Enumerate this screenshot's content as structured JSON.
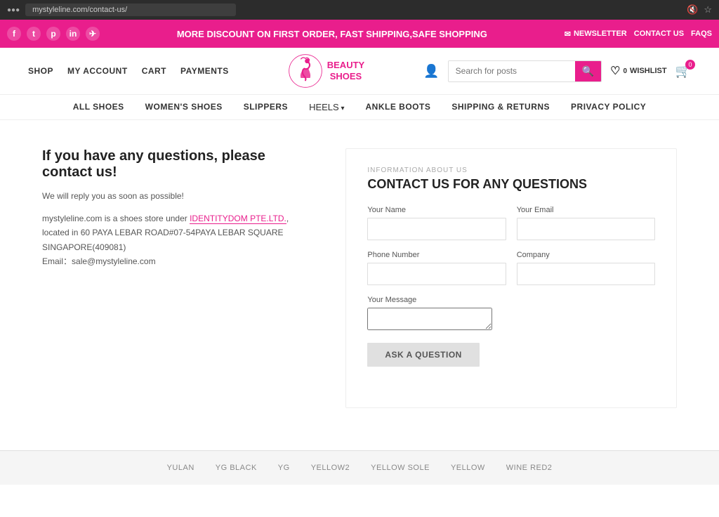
{
  "browser": {
    "url": "mystyleline.com/contact-us/"
  },
  "promo": {
    "text": "MORE DISCOUNT ON FIRST ORDER, FAST SHIPPING,SAFE SHOPPING",
    "newsletter_label": "NEWSLETTER",
    "contact_label": "CONTACT US",
    "faqs_label": "FAQS"
  },
  "header": {
    "nav_items": [
      "SHOP",
      "MY ACCOUNT",
      "CART",
      "PAYMENTS"
    ],
    "logo_line1": "BEAUTY",
    "logo_line2": "SHOES",
    "search_placeholder": "Search for posts",
    "wishlist_label": "WISHLIST",
    "wishlist_count": "0",
    "cart_count": "0"
  },
  "main_nav": {
    "items": [
      {
        "label": "ALL SHOES",
        "active": false
      },
      {
        "label": "WOMEN'S SHOES",
        "active": false
      },
      {
        "label": "SLIPPERS",
        "active": false
      },
      {
        "label": "HEELS",
        "active": false,
        "dropdown": true
      },
      {
        "label": "ANKLE BOOTS",
        "active": false
      },
      {
        "label": "SHIPPING & RETURNS",
        "active": false
      },
      {
        "label": "PRIVACY POLICY",
        "active": false
      }
    ]
  },
  "contact_left": {
    "heading": "If you have any questions, please contact us!",
    "subtext": "We will reply you as soon as possible!",
    "description_prefix": "mystyleline.com is a shoes store under ",
    "company_name": "IDENTITYDOM PTE.LTD.",
    "description_suffix": ", located in 60 PAYA LEBAR ROAD#07-54PAYA LEBAR SQUARE SINGAPORE(409081)",
    "email_label": "Email：",
    "email": "sale@mystyleline.com"
  },
  "contact_form": {
    "info_label": "INFORMATION ABOUT US",
    "title": "CONTACT US FOR ANY QUESTIONS",
    "name_label": "Your Name",
    "email_label": "Your Email",
    "phone_label": "Phone Number",
    "company_label": "Company",
    "message_label": "Your Message",
    "submit_label": "ASK A QUESTION"
  },
  "footer_tags": [
    "YULAN",
    "YG BLACK",
    "YG",
    "YELLOW2",
    "YELLOW SOLE",
    "YELLOW",
    "WINE RED2"
  ]
}
